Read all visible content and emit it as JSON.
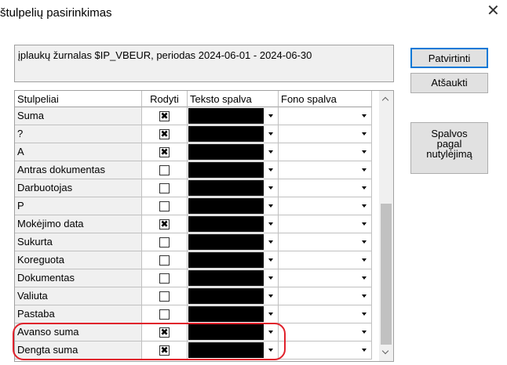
{
  "window": {
    "title": "štulpelių pasirinkimas",
    "close_glyph": "✕"
  },
  "description": "įplaukų žurnalas $IP_VBEUR, periodas 2024-06-01 - 2024-06-30",
  "buttons": {
    "confirm": "Patvirtinti",
    "cancel": "Atšaukti",
    "default_colors": [
      "Spalvos",
      "pagal",
      "nutylėjimą"
    ]
  },
  "grid": {
    "headers": {
      "column": "Stulpeliai",
      "show": "Rodyti",
      "text_color": "Teksto spalva",
      "bg_color": "Fono spalva"
    },
    "check_glyph": "✖",
    "rows": [
      {
        "name": "Suma",
        "show": true
      },
      {
        "name": "?",
        "show": true
      },
      {
        "name": "A",
        "show": true
      },
      {
        "name": "Antras dokumentas",
        "show": false
      },
      {
        "name": "Darbuotojas",
        "show": false
      },
      {
        "name": "P",
        "show": false
      },
      {
        "name": "Mokėjimo data",
        "show": true
      },
      {
        "name": "Sukurta",
        "show": false
      },
      {
        "name": "Koreguota",
        "show": false
      },
      {
        "name": "Dokumentas",
        "show": false
      },
      {
        "name": "Valiuta",
        "show": false
      },
      {
        "name": "Pastaba",
        "show": false
      },
      {
        "name": "Avanso suma",
        "show": true
      },
      {
        "name": "Dengta suma",
        "show": true
      }
    ],
    "text_color_value": "#000000",
    "bg_color_value": "#ffffff"
  },
  "colors": {
    "highlight": "#e0212b",
    "focus_border": "#0078d7"
  },
  "icons": [
    "close-icon",
    "dropdown-arrow-icon",
    "scroll-up-icon",
    "scroll-down-icon"
  ]
}
